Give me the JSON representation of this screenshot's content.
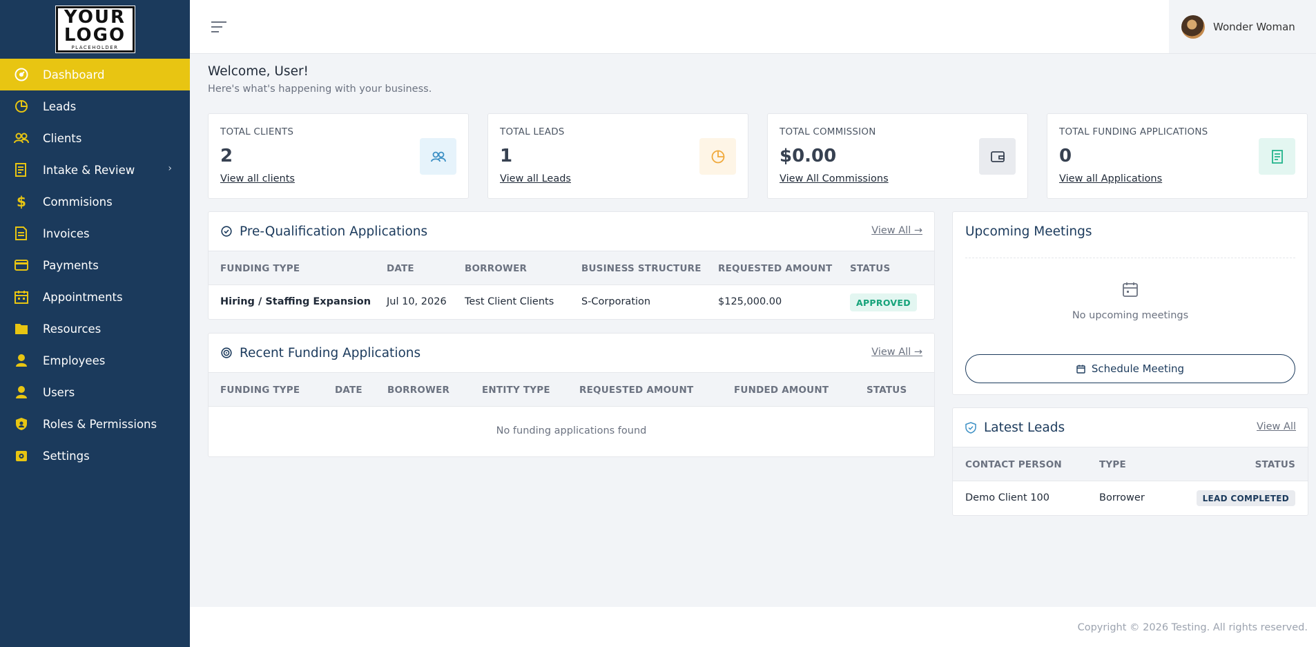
{
  "logo": {
    "line1": "YOUR",
    "line2": "LOGO",
    "line3": "PLACEHOLDER"
  },
  "sidebar": {
    "items": [
      {
        "label": "Dashboard",
        "icon": "dashboard-icon"
      },
      {
        "label": "Leads",
        "icon": "pie-chart-icon"
      },
      {
        "label": "Clients",
        "icon": "users-icon"
      },
      {
        "label": "Intake & Review",
        "icon": "clipboard-icon"
      },
      {
        "label": "Commisions",
        "icon": "dollar-icon"
      },
      {
        "label": "Invoices",
        "icon": "invoice-icon"
      },
      {
        "label": "Payments",
        "icon": "credit-card-icon"
      },
      {
        "label": "Appointments",
        "icon": "calendar-icon"
      },
      {
        "label": "Resources",
        "icon": "folder-icon"
      },
      {
        "label": "Employees",
        "icon": "user-icon"
      },
      {
        "label": "Users",
        "icon": "user-icon"
      },
      {
        "label": "Roles & Permissions",
        "icon": "shield-icon"
      },
      {
        "label": "Settings",
        "icon": "gear-icon"
      }
    ],
    "active_color": "#e8c512",
    "bg_color": "#1b3a5c"
  },
  "header": {
    "user_name": "Wonder Woman"
  },
  "welcome": {
    "title": "Welcome, User!",
    "subtitle": "Here's what's happening with your business."
  },
  "stats": [
    {
      "label": "TOTAL CLIENTS",
      "value": "2",
      "link": "View all clients",
      "icon": "users-icon",
      "icon_bg": "#e6f3fb",
      "icon_color": "#3b8fc4"
    },
    {
      "label": "TOTAL LEADS",
      "value": "1",
      "link": "View all Leads",
      "icon": "pie-chart-icon",
      "icon_bg": "#fef5e6",
      "icon_color": "#f0a93b"
    },
    {
      "label": "TOTAL COMMISSION",
      "value": "$0.00",
      "link": "View All Commissions",
      "icon": "wallet-icon",
      "icon_bg": "#e9ebef",
      "icon_color": "#374151"
    },
    {
      "label": "TOTAL FUNDING APPLICATIONS",
      "value": "0",
      "link": "View all Applications",
      "icon": "document-icon",
      "icon_bg": "#e3f6f1",
      "icon_color": "#20b38a"
    }
  ],
  "prequal": {
    "title": "Pre-Qualification Applications",
    "view_all": "View All →",
    "columns": [
      "FUNDING TYPE",
      "DATE",
      "BORROWER",
      "BUSINESS STRUCTURE",
      "REQUESTED AMOUNT",
      "STATUS"
    ],
    "rows": [
      {
        "funding_type": "Hiring / Staffing Expansion",
        "date": "Jul 10, 2026",
        "borrower": "Test Client Clients",
        "structure": "S-Corporation",
        "amount": "$125,000.00",
        "status": "APPROVED"
      }
    ]
  },
  "recent": {
    "title": "Recent Funding Applications",
    "view_all": "View All →",
    "columns": [
      "FUNDING TYPE",
      "DATE",
      "BORROWER",
      "ENTITY TYPE",
      "REQUESTED AMOUNT",
      "FUNDED AMOUNT",
      "STATUS"
    ],
    "empty": "No funding applications found"
  },
  "meetings": {
    "title": "Upcoming Meetings",
    "empty": "No upcoming meetings",
    "button": "Schedule Meeting"
  },
  "leads": {
    "title": "Latest Leads",
    "view_all": "View All",
    "columns": [
      "CONTACT PERSON",
      "TYPE",
      "STATUS"
    ],
    "rows": [
      {
        "contact": "Demo Client 100",
        "type": "Borrower",
        "status": "LEAD COMPLETED"
      }
    ]
  },
  "footer": {
    "copyright": "Copyright © 2026 Testing. All rights reserved."
  }
}
